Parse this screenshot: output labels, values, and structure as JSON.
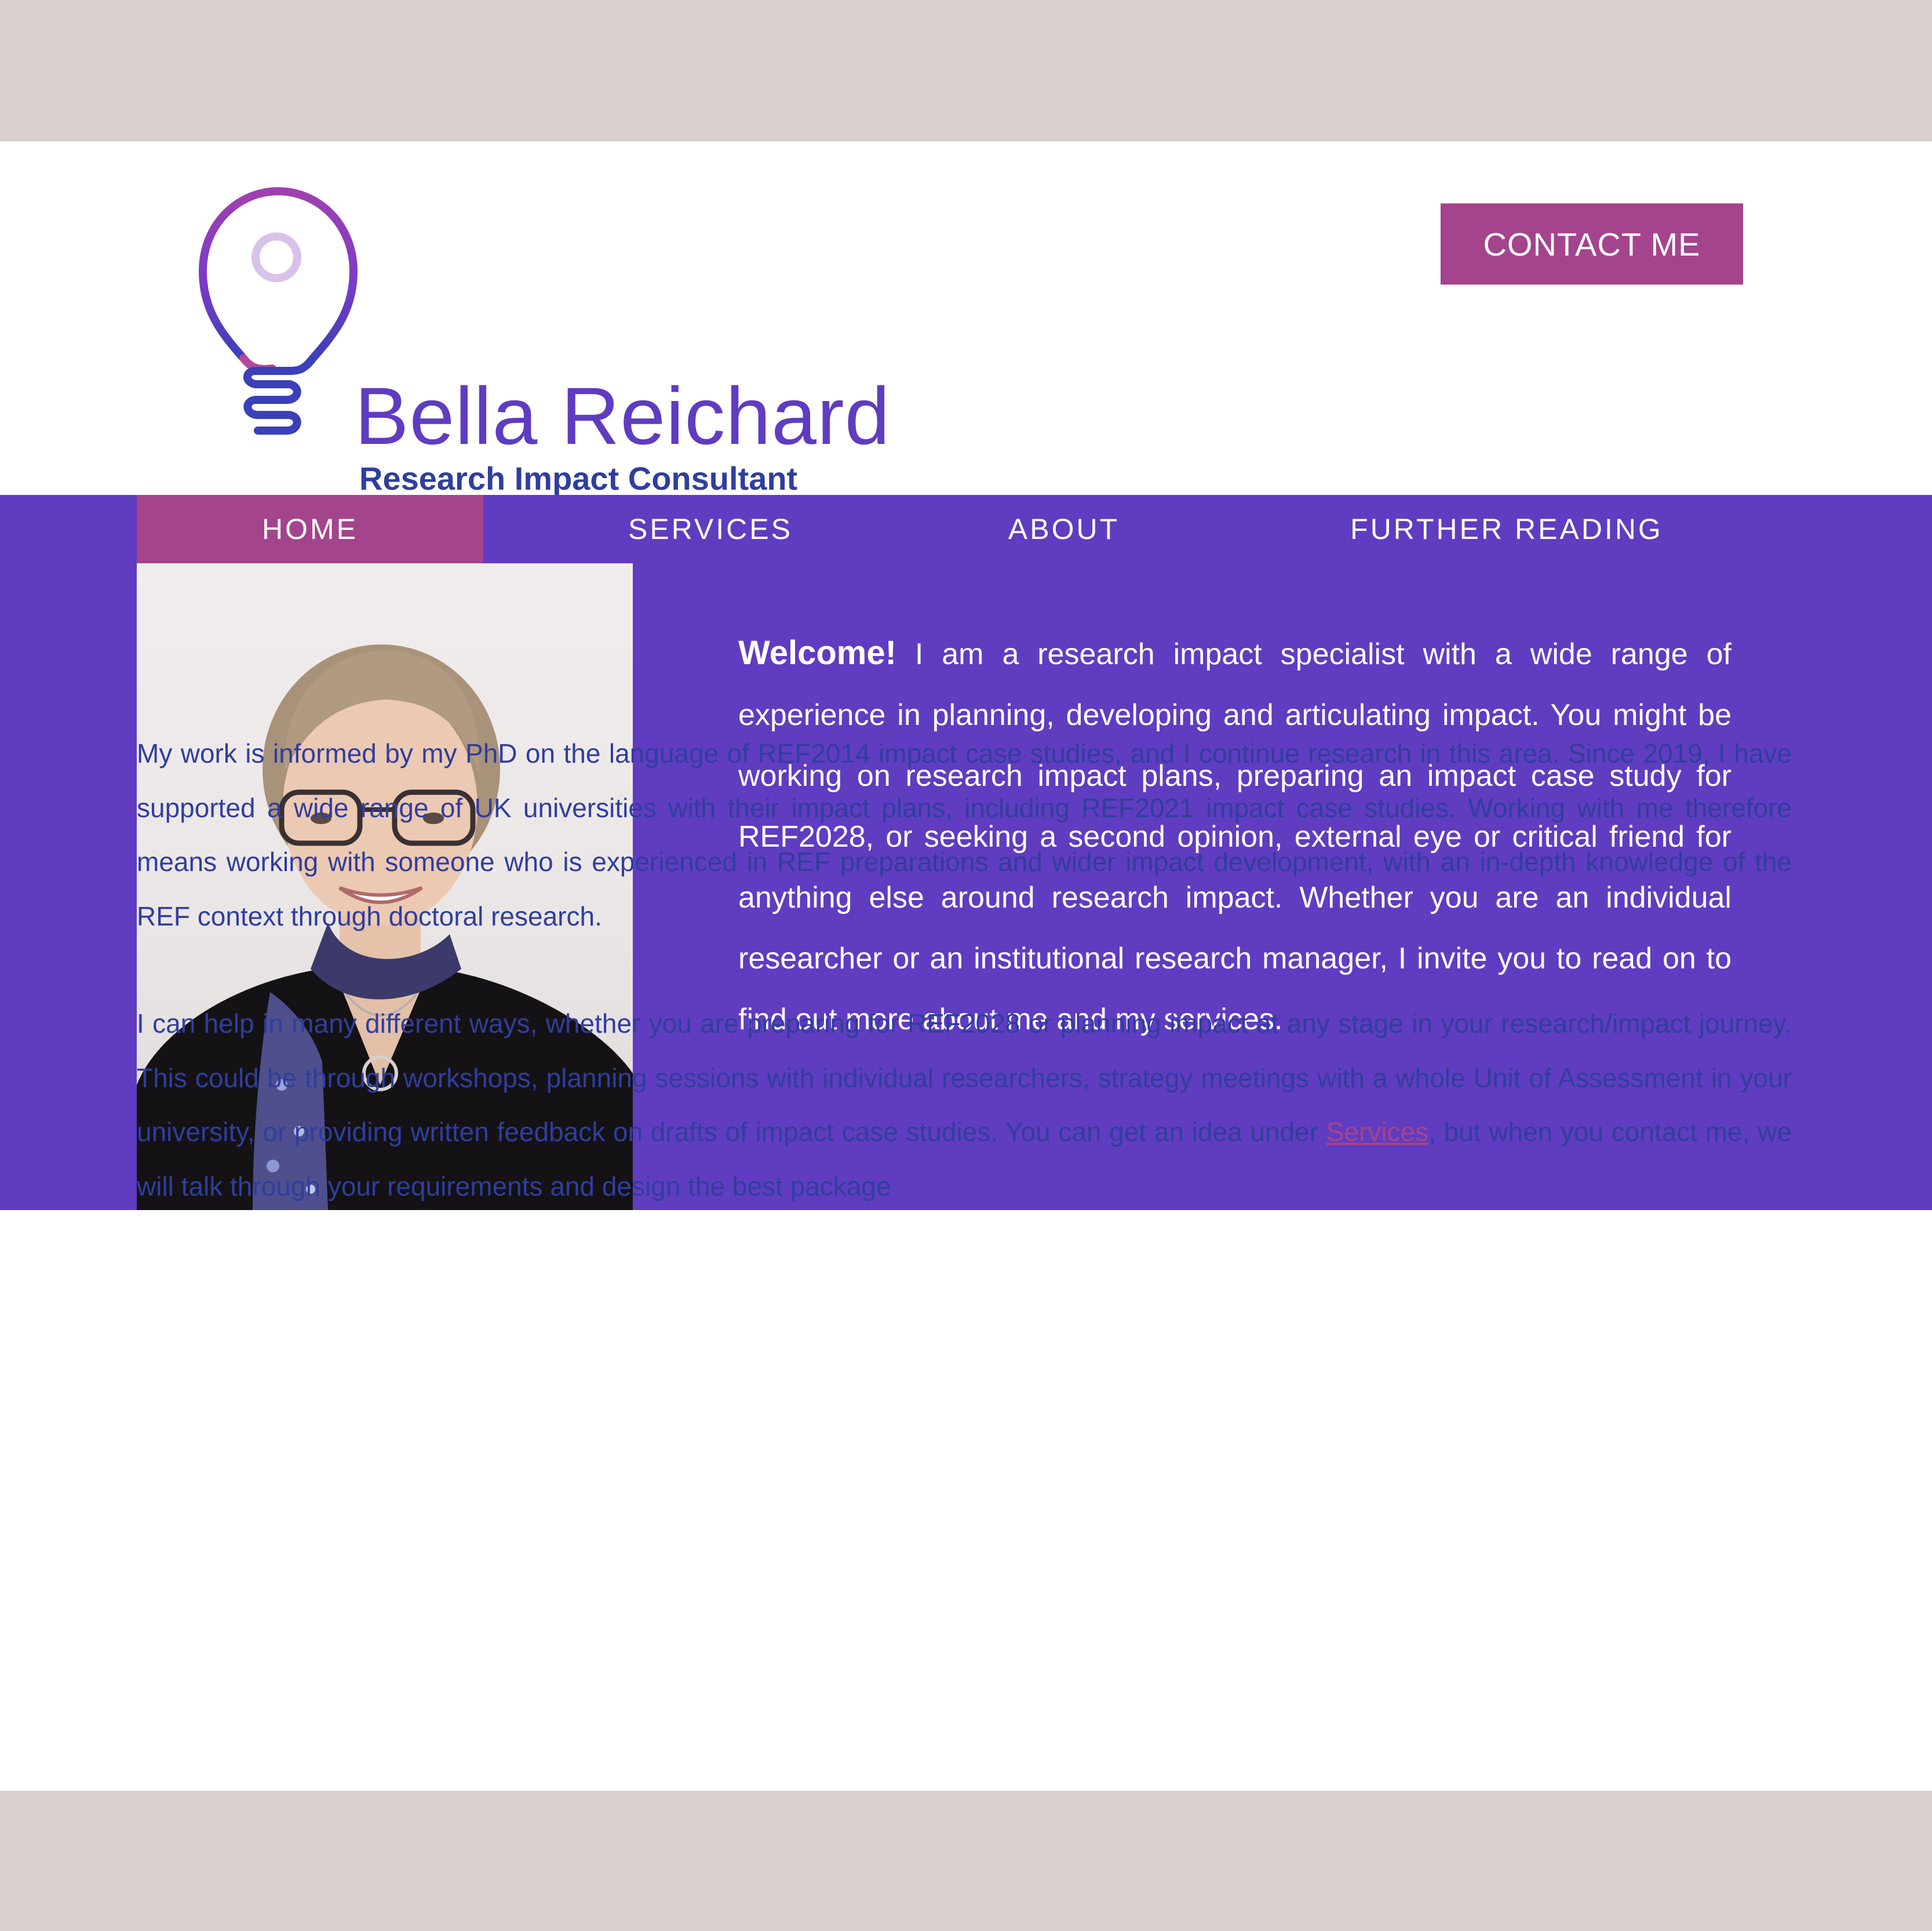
{
  "header": {
    "brand_name": "Bella Reichard",
    "brand_tagline": "Research Impact Consultant",
    "contact_label": "CONTACT ME"
  },
  "nav": {
    "items": [
      {
        "label": "HOME",
        "active": true
      },
      {
        "label": "SERVICES",
        "active": false
      },
      {
        "label": "ABOUT",
        "active": false
      },
      {
        "label": "FURTHER READING",
        "active": false
      }
    ]
  },
  "welcome": {
    "lead": "Welcome!",
    "text": " I am a research impact specialist with a wide range of experience in planning, developing and articulating impact. You might be working on research impact plans, preparing an impact case study for REF2028, or seeking a second opinion, external eye or critical friend for anything else around research impact. Whether you are an individual researcher or an institutional research manager, I invite you to read on to find out more about me and my services."
  },
  "body": {
    "paragraph1": "My work is informed by my PhD on the language of REF2014 impact case studies, and I continue research in this area. Since 2019, I have supported a wide range of UK universities with their impact plans, including REF2021 impact case studies. Working with me therefore means working with someone who is experienced in REF preparations and wider impact development, with an in-depth knowledge of the REF context through doctoral research.",
    "paragraph2_before": "I can help in many different ways, whether you are preparing for REF2028 or planning impact at any stage in your research/impact journey. This could be through workshops, planning sessions with individual researchers, strategy meetings with a whole Unit of Assessment in your university, or providing written feedback on drafts of impact case studies. You can get an idea under ",
    "paragraph2_link": "Services",
    "paragraph2_after": ", but when you contact me, we will talk through your requirements and design the best package"
  },
  "colors": {
    "purple": "#603cc0",
    "magenta": "#a4448c",
    "navy_text": "#2f3e9e",
    "page_bg": "#d8d0cd"
  },
  "icons": {
    "logo": "lightbulb-icon"
  }
}
